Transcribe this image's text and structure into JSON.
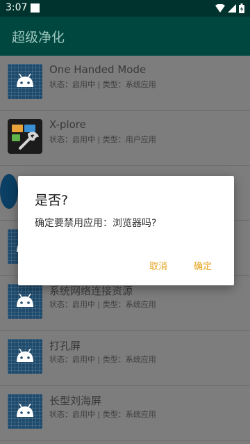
{
  "status_bar": {
    "time": "3:07"
  },
  "app_bar": {
    "title": "超级净化"
  },
  "apps": [
    {
      "name": "One Handed Mode",
      "status": "状态：启用中 | 类型：系统应用",
      "icon": "android-icon"
    },
    {
      "name": "X-plore",
      "status": "状态：启用中 | 类型：用户应用",
      "icon": "x-plore-icon"
    },
    {
      "name": "",
      "status": "",
      "icon": "app-icon"
    },
    {
      "name": "",
      "status": "",
      "icon": "android-icon"
    },
    {
      "name": "系统网络连接资源",
      "status": "状态：启用中 | 类型：系统应用",
      "icon": "android-icon"
    },
    {
      "name": "打孔屏",
      "status": "状态：启用中 | 类型：系统应用",
      "icon": "android-icon"
    },
    {
      "name": "长型刘海屏",
      "status": "状态：启用中 | 类型：系统应用",
      "icon": "android-icon"
    }
  ],
  "dialog": {
    "title": "是否?",
    "message": "确定要禁用应用：浏览器吗?",
    "cancel_label": "取消",
    "confirm_label": "确定"
  },
  "colors": {
    "status_bar": "#00332d",
    "app_bar": "#00483f",
    "accent": "#e5a31b",
    "dim_background": "#7d7d7d"
  }
}
